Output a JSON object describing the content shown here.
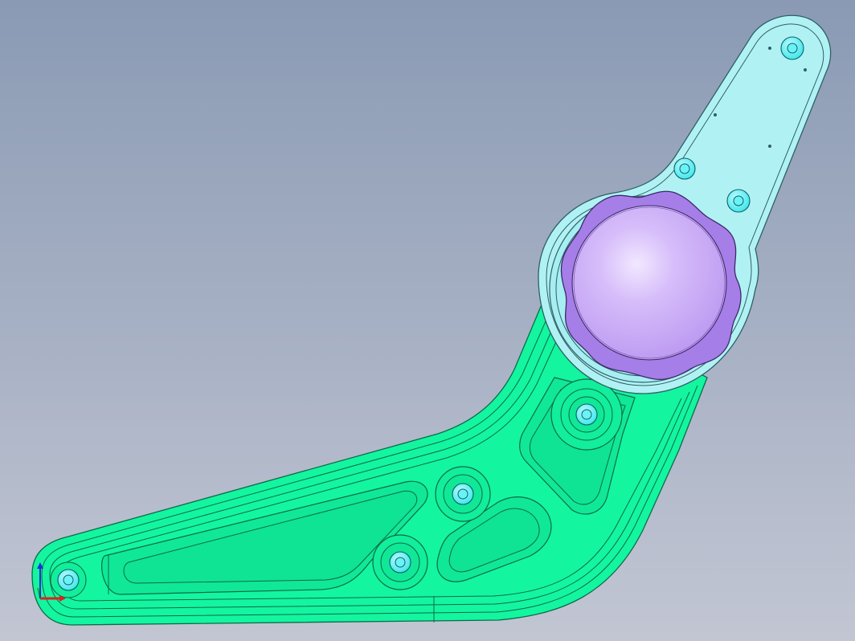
{
  "viewport": {
    "background_top": "#8a9ab4",
    "background_bottom": "#c2c6d3"
  },
  "model": {
    "main_arm_color": "#14f5a0",
    "main_arm_edge": "#0b6b48",
    "bracket_color": "#b0f2f4",
    "bracket_edge": "#2f5f66",
    "knob_color": "#b995f0",
    "knob_highlight": "#f2e8ff",
    "fastener_color": "#38e6ea",
    "fastener_dark": "#0f5f66"
  },
  "triad": {
    "x_axis_color": "#e02020",
    "y_axis_color": "#2030d8",
    "z_axis_color": "#20b020"
  }
}
